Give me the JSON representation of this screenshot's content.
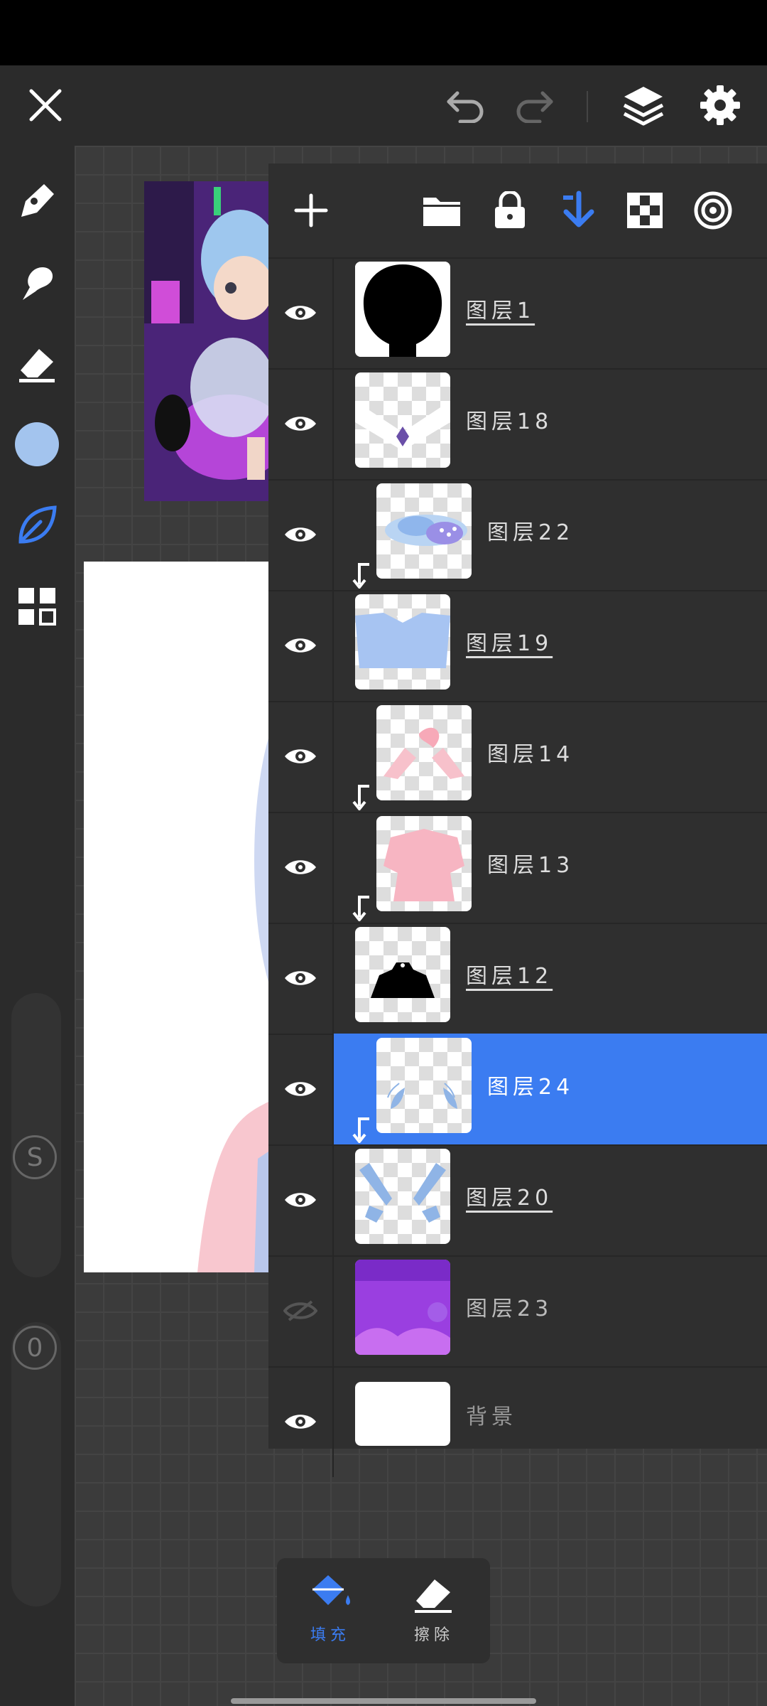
{
  "layers": [
    {
      "name": "图层1",
      "visible": true,
      "clipped": false,
      "selected": false,
      "underline": true,
      "thumb": "head-silhouette"
    },
    {
      "name": "图层18",
      "visible": true,
      "clipped": false,
      "selected": false,
      "underline": false,
      "thumb": "collar"
    },
    {
      "name": "图层22",
      "visible": true,
      "clipped": true,
      "selected": false,
      "underline": false,
      "thumb": "blue-cloud"
    },
    {
      "name": "图层19",
      "visible": true,
      "clipped": false,
      "selected": false,
      "underline": true,
      "thumb": "blue-top"
    },
    {
      "name": "图层14",
      "visible": true,
      "clipped": true,
      "selected": false,
      "underline": false,
      "thumb": "pink-sleeves"
    },
    {
      "name": "图层13",
      "visible": true,
      "clipped": true,
      "selected": false,
      "underline": false,
      "thumb": "pink-dress"
    },
    {
      "name": "图层12",
      "visible": true,
      "clipped": false,
      "selected": false,
      "underline": true,
      "thumb": "black-shoulders"
    },
    {
      "name": "图层24",
      "visible": true,
      "clipped": true,
      "selected": true,
      "underline": false,
      "thumb": "leaf-pattern"
    },
    {
      "name": "图层20",
      "visible": true,
      "clipped": false,
      "selected": false,
      "underline": true,
      "thumb": "blue-ribbons"
    },
    {
      "name": "图层23",
      "visible": false,
      "clipped": false,
      "selected": false,
      "underline": false,
      "thumb": "purple-bg"
    },
    {
      "name": "背景",
      "visible": true,
      "clipped": false,
      "selected": false,
      "underline": false,
      "thumb": "white"
    }
  ],
  "bottom_tools": {
    "fill_label": "填充",
    "erase_label": "擦除"
  },
  "left_toolbar": {
    "size_slider_label": "S",
    "opacity_slider_label": "0"
  },
  "colors": {
    "accent": "#3b7cf1",
    "current_color": "#a3c4ee",
    "panel": "#2f2f2f"
  }
}
